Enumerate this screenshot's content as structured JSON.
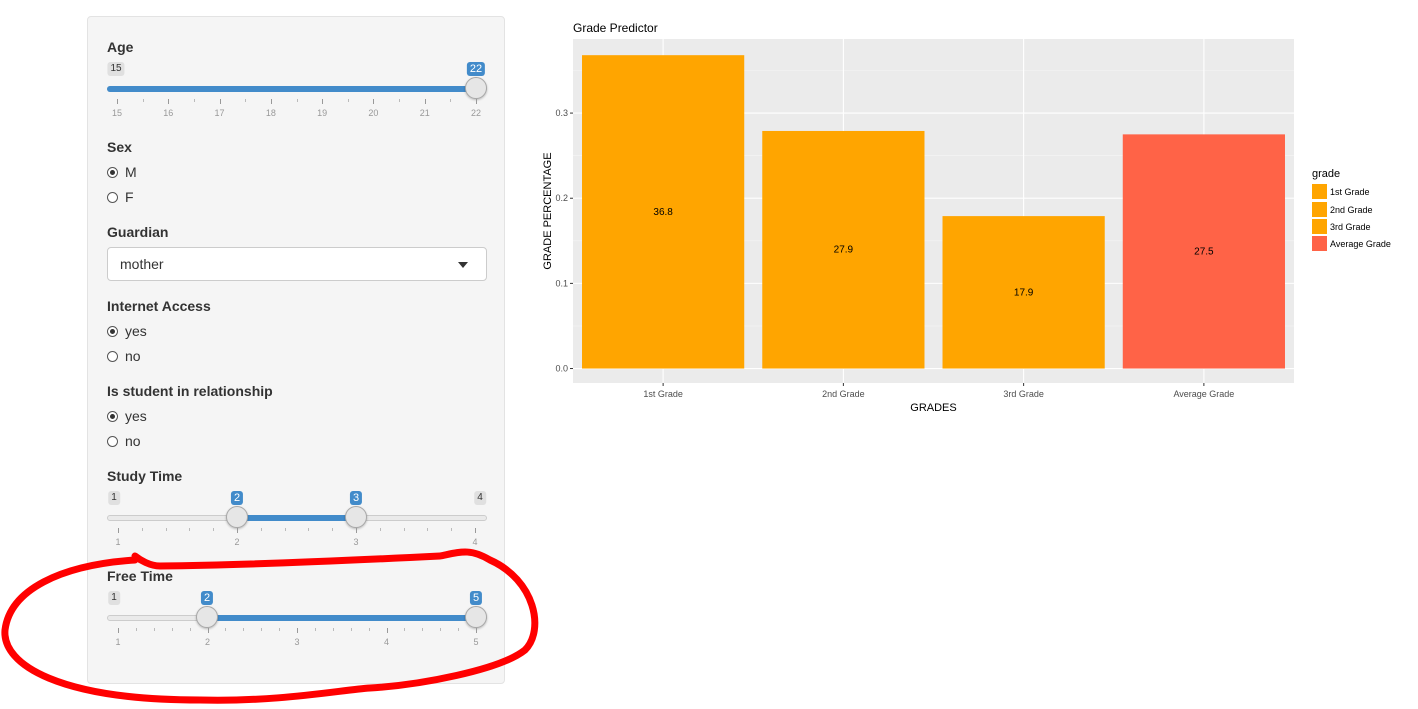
{
  "sidebar": {
    "age": {
      "label": "Age",
      "min": 15,
      "max": 22,
      "value": 22,
      "min_text": "15",
      "value_text": "22",
      "ticks": [
        "15",
        "16",
        "17",
        "18",
        "19",
        "20",
        "21",
        "22"
      ]
    },
    "sex": {
      "label": "Sex",
      "options": [
        "M",
        "F"
      ],
      "selected": "M"
    },
    "guardian": {
      "label": "Guardian",
      "value": "mother"
    },
    "internet": {
      "label": "Internet Access",
      "options": [
        "yes",
        "no"
      ],
      "selected": "yes"
    },
    "relationship": {
      "label": "Is student in relationship",
      "options": [
        "yes",
        "no"
      ],
      "selected": "yes"
    },
    "study_time": {
      "label": "Study Time",
      "min": 1,
      "max": 4,
      "low": 2,
      "high": 3,
      "min_text": "1",
      "max_text": "4",
      "low_text": "2",
      "high_text": "3",
      "ticks": [
        "1",
        "2",
        "3",
        "4"
      ]
    },
    "free_time": {
      "label": "Free Time",
      "min": 1,
      "max": 5,
      "low": 2,
      "high": 5,
      "min_text": "1",
      "low_text": "2",
      "high_text": "5",
      "ticks": [
        "1",
        "2",
        "3",
        "4",
        "5"
      ]
    }
  },
  "colors": {
    "accent": "#428bca",
    "bar_orange": "#ffa500",
    "bar_red": "#ff6347",
    "annotation": "#ff0000",
    "panel_bg": "#ebebeb"
  },
  "chart_data": {
    "type": "bar",
    "title": "Grade Predictor",
    "xlabel": "GRADES",
    "ylabel": "GRADE PERCENTAGE",
    "categories": [
      "1st Grade",
      "2nd Grade",
      "3rd Grade",
      "Average Grade"
    ],
    "values": [
      0.368,
      0.279,
      0.179,
      0.275
    ],
    "labels": [
      "36.8",
      "27.9",
      "17.9",
      "27.5"
    ],
    "bar_colors": [
      "#ffa500",
      "#ffa500",
      "#ffa500",
      "#ff6347"
    ],
    "yticks": [
      "0.0",
      "0.1",
      "0.2",
      "0.3"
    ],
    "ylim": [
      -0.017,
      0.387
    ],
    "grid": true,
    "legend": {
      "title": "grade",
      "position": "right",
      "items": [
        {
          "label": "1st Grade",
          "color": "#ffa500"
        },
        {
          "label": "2nd Grade",
          "color": "#ffa500"
        },
        {
          "label": "3rd Grade",
          "color": "#ffa500"
        },
        {
          "label": "Average Grade",
          "color": "#ff6347"
        }
      ]
    }
  }
}
